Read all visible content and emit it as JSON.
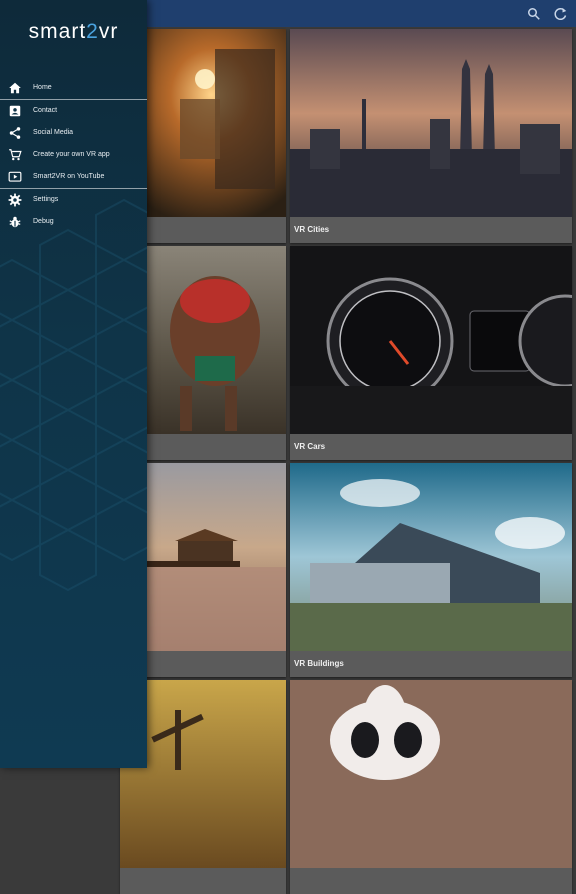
{
  "app": {
    "brand_prefix": "smart",
    "brand_digit": "2",
    "brand_suffix": "vr"
  },
  "drawer": {
    "items": [
      {
        "label": "Home",
        "icon": "home-icon"
      },
      {
        "label": "Contact",
        "icon": "contact-icon"
      },
      {
        "label": "Social Media",
        "icon": "share-icon"
      },
      {
        "label": "Create your own VR app",
        "icon": "cart-icon"
      },
      {
        "label": "Smart2VR on YouTube",
        "icon": "youtube-icon"
      },
      {
        "label": "Settings",
        "icon": "gear-icon"
      },
      {
        "label": "Debug",
        "icon": "bug-icon"
      }
    ]
  },
  "grid": {
    "cards": [
      {
        "label": ""
      },
      {
        "label": "VR Cities"
      },
      {
        "label": ""
      },
      {
        "label": "VR Cars"
      },
      {
        "label": ""
      },
      {
        "label": "VR Buildings"
      },
      {
        "label": ""
      },
      {
        "label": ""
      }
    ]
  },
  "colors": {
    "appbar": "#1f3f6e",
    "accent": "#4aa3df"
  }
}
